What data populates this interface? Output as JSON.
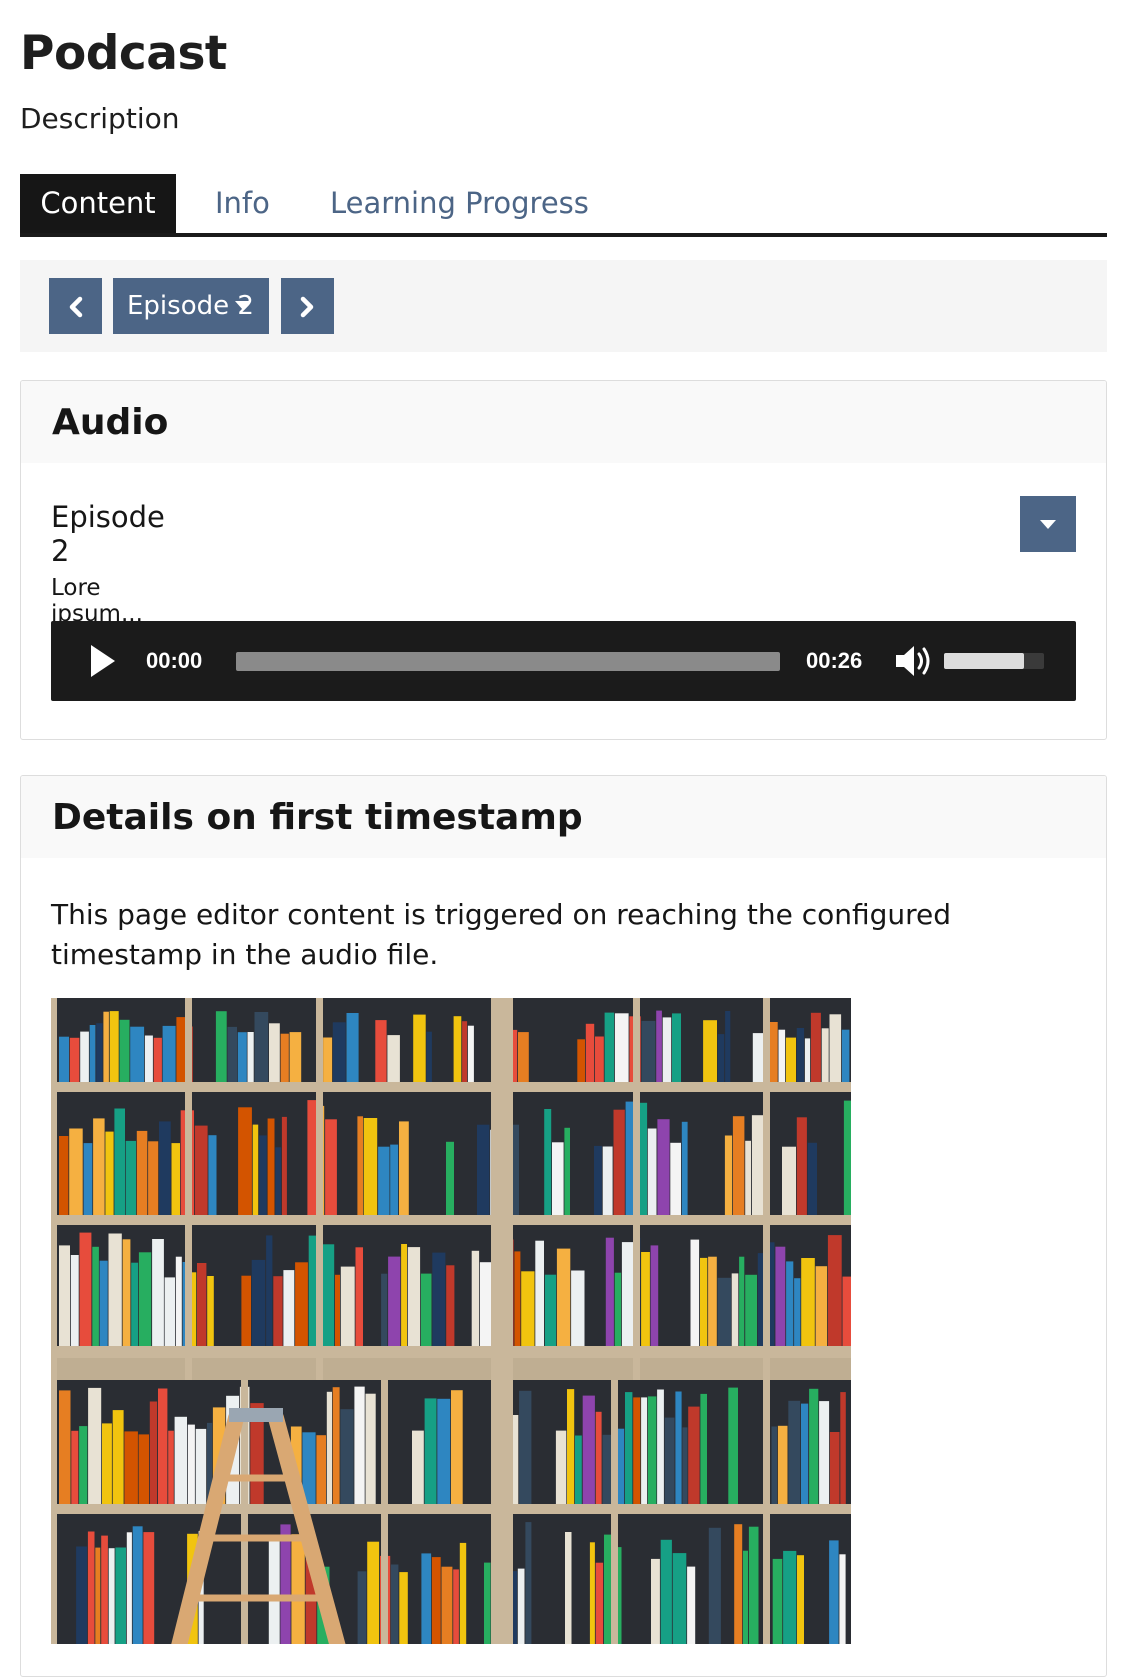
{
  "page": {
    "title": "Podcast",
    "description": "Description"
  },
  "tabs": [
    {
      "label": "Content",
      "active": true
    },
    {
      "label": "Info",
      "active": false
    },
    {
      "label": "Learning Progress",
      "active": false
    }
  ],
  "episode_nav": {
    "prev_icon": "chevron-left-icon",
    "current_label": "Episode 2",
    "dropdown_icon": "caret-down-icon",
    "next_icon": "chevron-right-icon"
  },
  "audio_panel": {
    "title": "Audio",
    "episode_title": "Episode 2",
    "toggle_icon": "caret-down-icon",
    "episode_description": "Lore ipsum...",
    "player": {
      "play_icon": "play-icon",
      "current_time": "00:00",
      "duration": "00:26",
      "progress": 0,
      "volume_icon": "volume-icon",
      "volume": 0.8
    }
  },
  "details_panel": {
    "title": "Details on first timestamp",
    "text": "This page editor content is triggered on reaching the configured timestamp in the audio file.",
    "image_subject": "bookshelf photo"
  },
  "colors": {
    "accent": "#4c6586",
    "tab_active_bg": "#161616",
    "nav_bar_bg": "#f5f5f5",
    "panel_header_bg": "#f9f9f9",
    "player_bg": "#1b1b1b"
  }
}
